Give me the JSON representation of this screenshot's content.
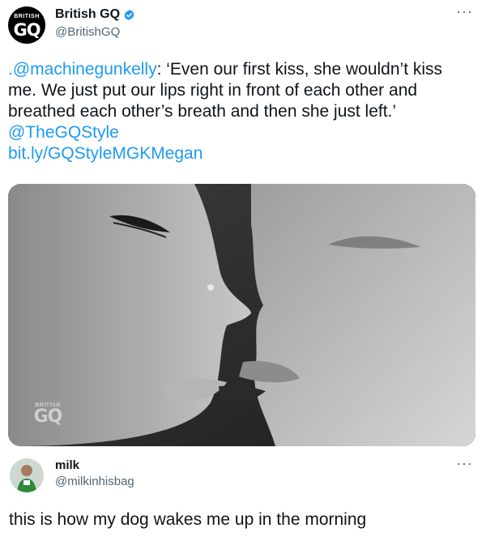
{
  "tweet": {
    "avatar_text_small": "BRITISH",
    "avatar_text_big": "GQ",
    "display_name": "British GQ",
    "handle": "@BritishGQ",
    "more": "···",
    "mention": ".@machinegunkelly",
    "quote_text": ": ‘Even our first kiss, she wouldn’t kiss me. We just put our lips right in front of each other and breathed each other’s breath and then she just left.’ ",
    "style_mention": "@TheGQStyle",
    "short_link": "bit.ly/GQStyleMGKMegan",
    "watermark_small": "BRITISH",
    "watermark_big": "GQ"
  },
  "reply": {
    "display_name": "milk",
    "handle": "@milkinhisbag",
    "more": "···",
    "text": "this is how my dog wakes me up in the morning"
  },
  "colors": {
    "link": "#1d9bf0",
    "verified": "#1d9bf0",
    "secondary_text": "#536471"
  },
  "icons": {
    "verified": "verified-badge-icon",
    "more": "more-options-icon"
  }
}
